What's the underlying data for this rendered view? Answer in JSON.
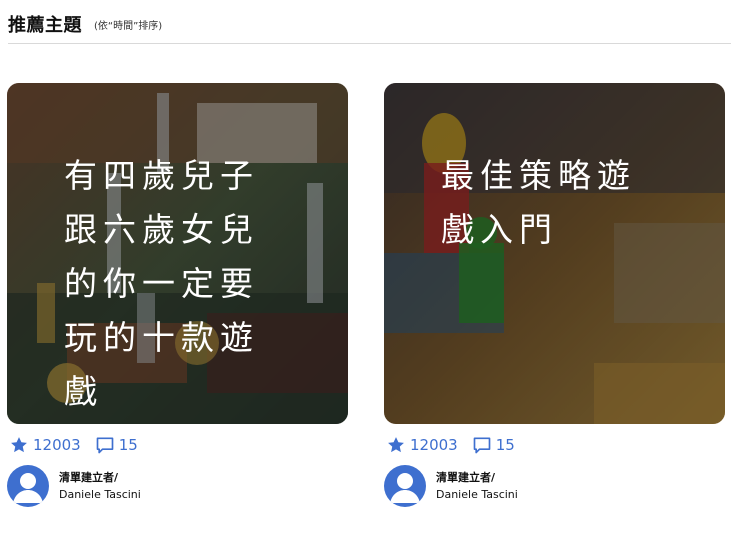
{
  "header": {
    "title": "推薦主題",
    "subtitle": "(依“時間”排序)"
  },
  "colors": {
    "accent": "#3e6fcf",
    "divider": "#d9d9d9"
  },
  "cards": [
    {
      "title": "有四歲兒子跟六歲女兒的你一定要玩的十款遊戲",
      "likes": "12003",
      "comments": "15",
      "author_role": "清單建立者/",
      "author_name": "Daniele Tascini",
      "like_icon": "star-icon",
      "comment_icon": "comment-icon",
      "avatar_icon": "user-icon"
    },
    {
      "title": "最佳策略遊戲入門",
      "likes": "12003",
      "comments": "15",
      "author_role": "清單建立者/",
      "author_name": "Daniele Tascini",
      "like_icon": "star-icon",
      "comment_icon": "comment-icon",
      "avatar_icon": "user-icon"
    }
  ]
}
